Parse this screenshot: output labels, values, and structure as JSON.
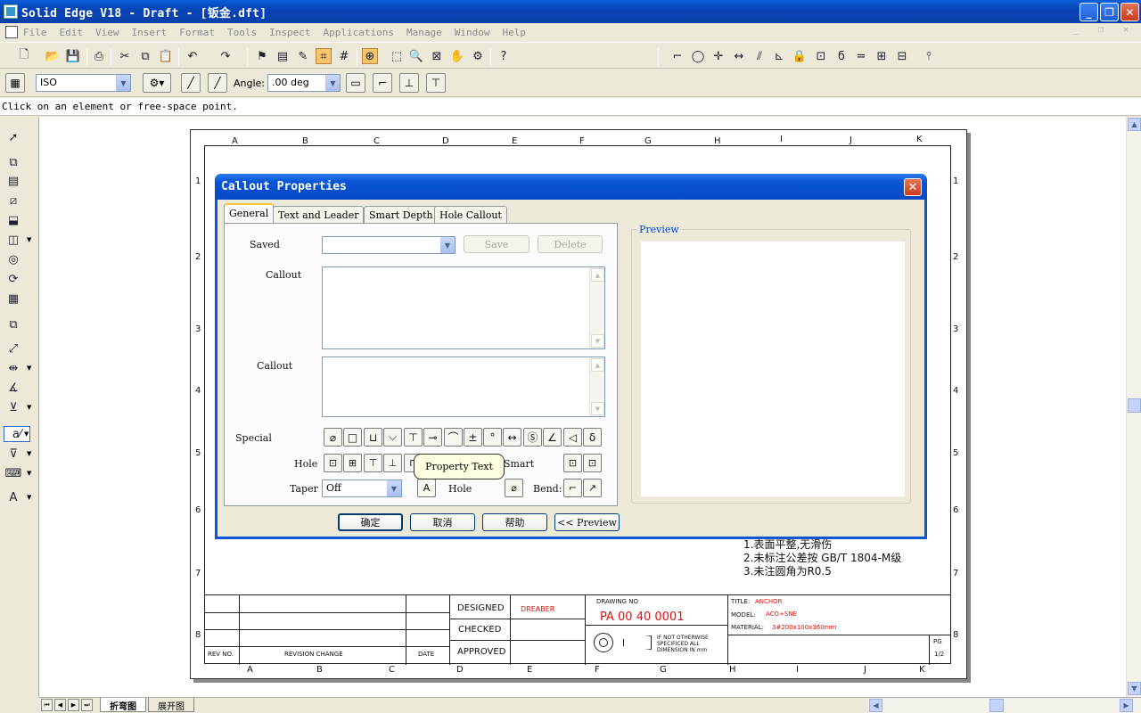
{
  "window": {
    "title": "Solid Edge V18 - Draft - [钣金.dft]",
    "buttons": [
      "_",
      "❐",
      "✕"
    ]
  },
  "menubar": {
    "items": [
      "File",
      "Edit",
      "View",
      "Insert",
      "Format",
      "Tools",
      "Inspect",
      "Applications",
      "Manage",
      "Window",
      "Help"
    ]
  },
  "toolbar2": {
    "style_value": "ISO",
    "angle_label": "Angle:",
    "angle_value": ".00 deg"
  },
  "prompt": "Click on an element or free-space point.",
  "drawing": {
    "zone_letters_top": [
      "A",
      "B",
      "C",
      "D",
      "E",
      "F",
      "G",
      "H",
      "I",
      "J",
      "K"
    ],
    "zone_letters_bottom": [
      "A",
      "B",
      "C",
      "D",
      "E",
      "F",
      "G",
      "H",
      "I",
      "J",
      "K"
    ],
    "zone_numbers": [
      "1",
      "2",
      "3",
      "4",
      "5",
      "6",
      "7",
      "8"
    ],
    "notes": [
      "1.表面平整,无滑伤",
      "2.未标注公差按 GB/T 1804-M级",
      "3.未注圆角为R0.5"
    ],
    "title_block": {
      "rev_no": "REV NO.",
      "revision_change": "REVISION CHANGE",
      "date": "DATE",
      "designed": "DESIGNED",
      "designer": "DREABER",
      "checked": "CHECKED",
      "approved": "APPROVED",
      "drawing_no_label": "DRAWING NO",
      "drawing_no": "PA 00 40 0001",
      "unit_note": [
        "IF NOT OTHERWISE",
        "SPECIFICED ALL",
        "DIMENSION IN mm"
      ],
      "title_label": "TITLE:",
      "title_value": "ANCHOR",
      "model_label": "MODEL:",
      "model_value": "ACO+SNE",
      "material_label": "MATERIAL:",
      "material_value": "3#200x100x360mm",
      "pg_label": "PG",
      "pg_value": "1/2"
    }
  },
  "dialog": {
    "title": "Callout Properties",
    "tabs": [
      "General",
      "Text and Leader",
      "Smart Depth",
      "Hole Callout"
    ],
    "saved_label": "Saved",
    "saved_value": "",
    "save_button": "Save",
    "delete_button": "Delete",
    "callout_label_1": "Callout",
    "callout_label_2": "Callout",
    "callout_text_1": "",
    "callout_text_2": "",
    "special_label": "Special",
    "special_symbols": [
      "⌀",
      "□",
      "⊔",
      "⌵",
      "⊤",
      "⊸",
      "⌒",
      "±",
      "°",
      "↔",
      "Ⓢ",
      "∠",
      "◁",
      "δ"
    ],
    "hole_label": "Hole",
    "smart_label": "Smart",
    "taper_label": "Taper",
    "taper_value": "Off",
    "hole_label_2": "Hole",
    "bend_label": "Bend:",
    "tooltip": "Property Text",
    "preview_label": "Preview",
    "ok_button": "确定",
    "cancel_button": "取消",
    "help_button": "帮助",
    "preview_button": "<< Preview"
  },
  "sheet_tabs": [
    "折弯图",
    "展开图"
  ]
}
